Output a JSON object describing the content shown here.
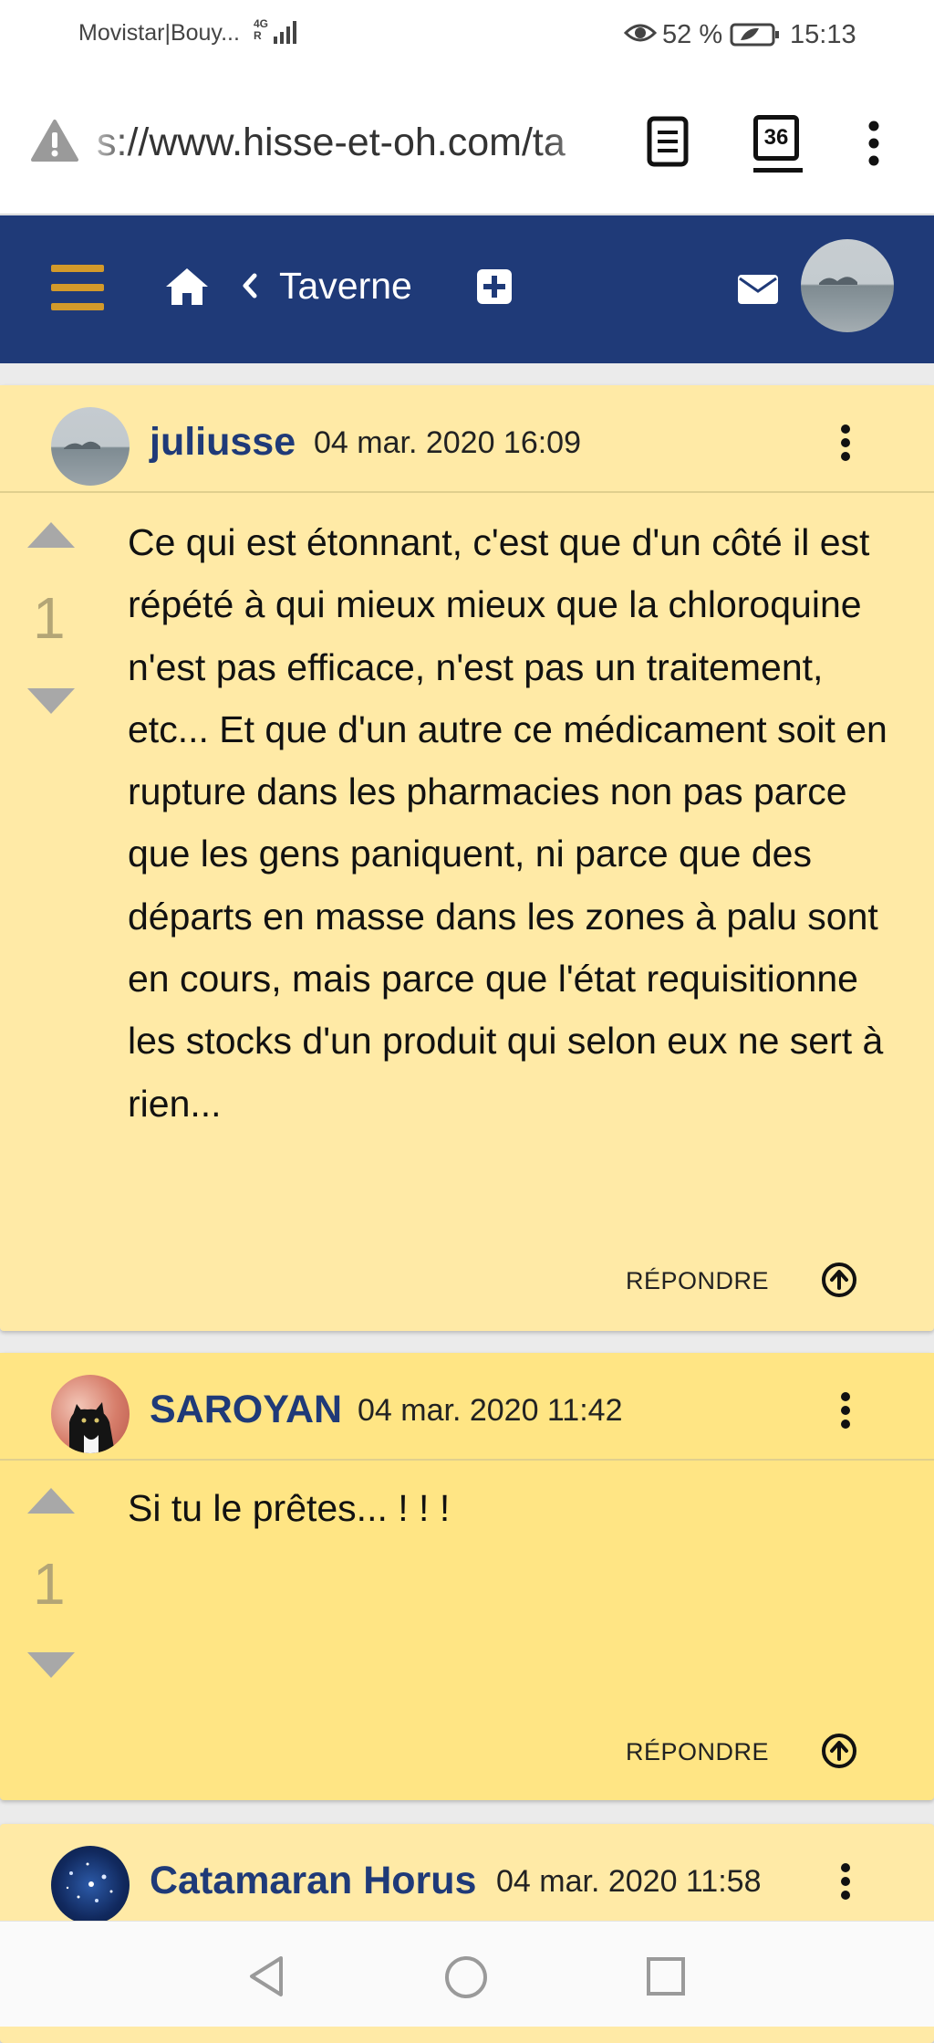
{
  "status_bar": {
    "carrier": "Movistar|Bouy...",
    "network": "4G R",
    "battery_percent": "52 %",
    "time": "15:13"
  },
  "browser": {
    "url": "s://www.hisse-et-oh.com/ta",
    "tab_count": "36"
  },
  "site_header": {
    "forum_name": "Taverne"
  },
  "posts": [
    {
      "author": "juliusse",
      "date": "04 mar. 2020 16:09",
      "votes": "1",
      "body": "Ce qui est étonnant, c'est que d'un côté il est répété à qui mieux mieux que la chloroquine n'est pas efficace, n'est pas un traitement, etc... Et que d'un autre ce médicament soit en rupture dans les pharmacies non pas parce que les gens paniquent, ni parce que des départs en masse dans les zones à palu sont en cours, mais parce que l'état requisitionne les stocks d'un produit qui selon eux ne sert à rien...",
      "reply_label": "RÉPONDRE"
    },
    {
      "author": "SAROYAN",
      "date": "04 mar. 2020 11:42",
      "votes": "1",
      "body": "Si tu le prêtes... ! ! !",
      "reply_label": "RÉPONDRE"
    },
    {
      "author": "Catamaran Horus",
      "date": "04 mar. 2020 11:58"
    }
  ],
  "colors": {
    "header_blue": "#1f3a78",
    "hamburger_gold": "#d39a2a",
    "post_light_yellow": "#ffeaa6",
    "post_yellow": "#ffe584"
  }
}
